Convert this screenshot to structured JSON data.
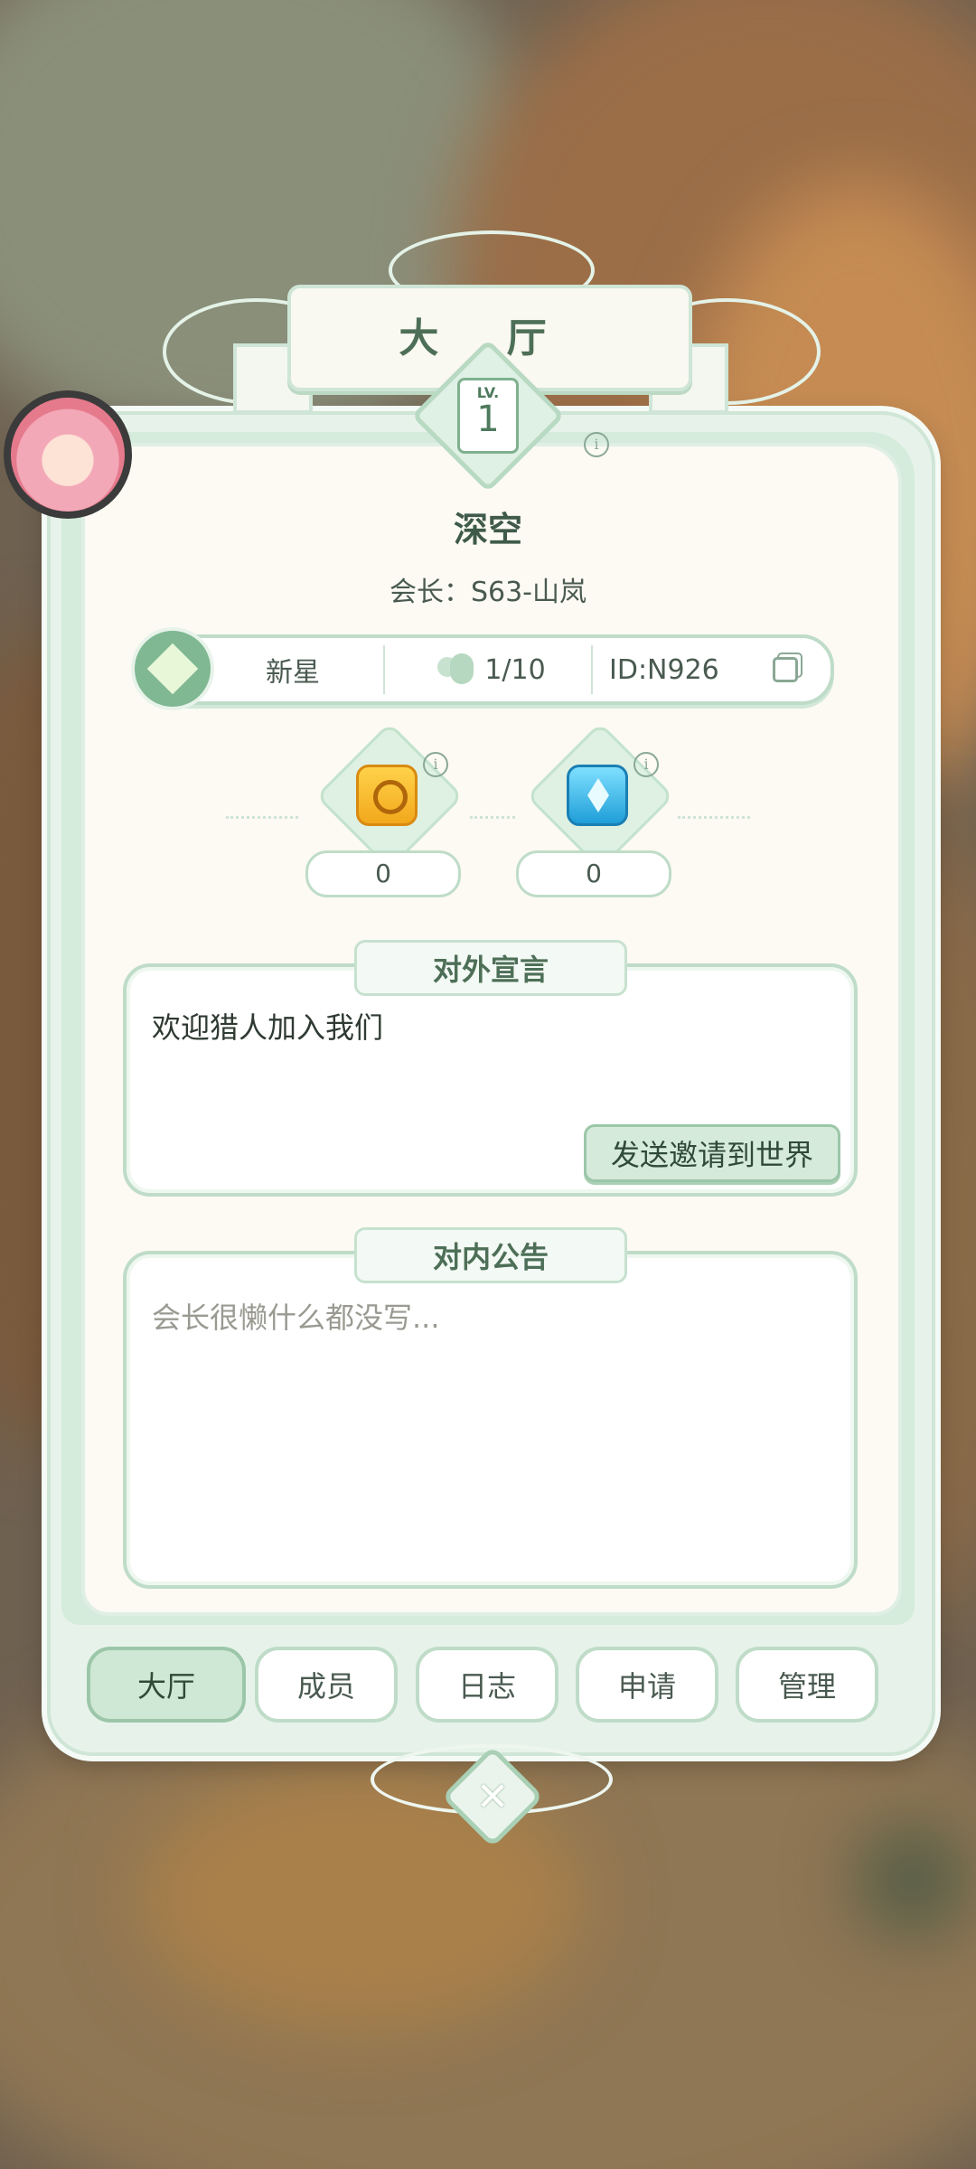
{
  "header": {
    "title": "大 厅",
    "level_label": "LV.",
    "level": "1"
  },
  "guild": {
    "name": "深空",
    "leader": "会长：S63-山岚"
  },
  "infobar": {
    "rank": "新星",
    "members": "1/10",
    "id": "ID:N926"
  },
  "resources": [
    {
      "icon": "gold-coin-icon",
      "value": "0"
    },
    {
      "icon": "blue-crystal-icon",
      "value": "0"
    }
  ],
  "declaration": {
    "tag": "对外宣言",
    "text": "欢迎猎人加入我们",
    "send_label": "发送邀请到世界"
  },
  "notice": {
    "tag": "对内公告",
    "placeholder": "会长很懒什么都没写..."
  },
  "tabs": [
    {
      "label": "大厅",
      "active": true
    },
    {
      "label": "成员",
      "active": false
    },
    {
      "label": "日志",
      "active": false
    },
    {
      "label": "申请",
      "active": false
    },
    {
      "label": "管理",
      "active": false
    }
  ],
  "colors": {
    "accent": "#9cc6a9",
    "panel": "#fcfaf3",
    "text": "#4a5a50"
  }
}
